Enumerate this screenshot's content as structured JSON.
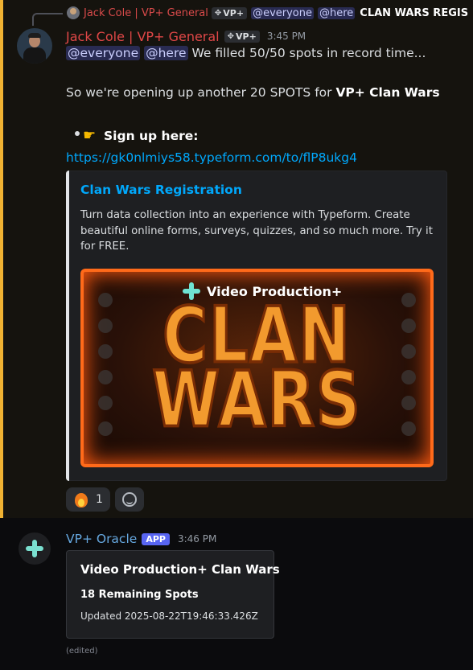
{
  "reply": {
    "author": "Jack Cole | VP+ General",
    "tag": "VP+",
    "mention_everyone": "@everyone",
    "mention_here": "@here",
    "snippet": "CLAN WARS REGIS"
  },
  "message1": {
    "author": "Jack Cole | VP+ General",
    "author_color": "#e04747",
    "tag": "VP+",
    "time": "3:45 PM",
    "mention_everyone": "@everyone",
    "mention_here": "@here",
    "line1_text": "We filled 50/50 spots in record time...",
    "line2_prefix": "So we're opening up another 20 SPOTS for ",
    "line2_bold": "VP+ Clan Wars",
    "bullet_icon": "pointing-hand-icon",
    "bullet_text": "Sign up here:",
    "link": "https://gk0nlmiys58.typeform.com/to/flP8ukg4",
    "highlight_color": "#f0b232"
  },
  "embed": {
    "title": "Clan Wars Registration",
    "description": "Turn data collection into an experience with Typeform. Create beautiful online forms, surveys, quizzes, and so much more. Try it for FREE.",
    "image": {
      "brand": "Video Production+",
      "line1": "CLAN",
      "line2": "WARS"
    }
  },
  "reactions": [
    {
      "icon": "fire-icon",
      "count": "1"
    },
    {
      "icon": "add-reaction-icon"
    }
  ],
  "message2": {
    "author": "VP+ Oracle",
    "author_color": "#66a8e0",
    "badge": "APP",
    "time": "3:46 PM",
    "embed_title": "Video Production+ Clan Wars",
    "embed_spots": "18 Remaining Spots",
    "embed_updated": "Updated 2025-08-22T19:46:33.426Z",
    "edited": "(edited)"
  }
}
